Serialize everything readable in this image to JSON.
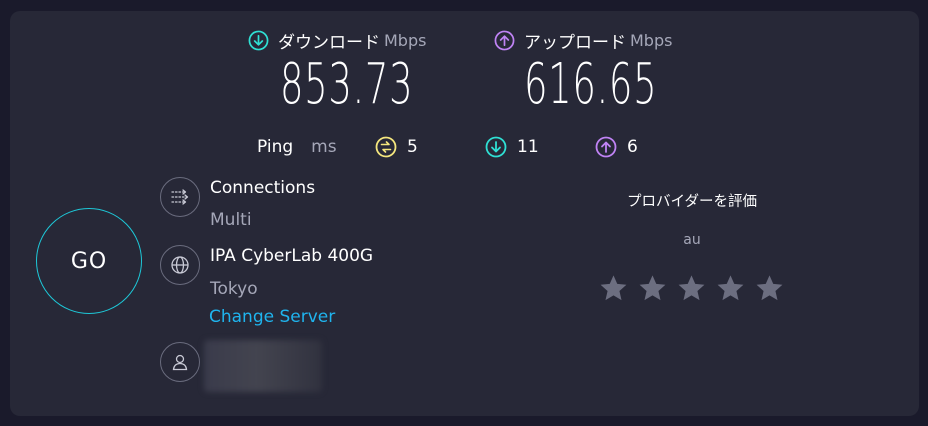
{
  "download": {
    "label": "ダウンロード",
    "unit": "Mbps",
    "value": "853.73",
    "icon": "arrow-down-circle-icon"
  },
  "upload": {
    "label": "アップロード",
    "unit": "Mbps",
    "value": "616.65",
    "icon": "arrow-up-circle-icon"
  },
  "ping": {
    "label": "Ping",
    "unit": "ms",
    "idle": "5",
    "download": "11",
    "upload": "6"
  },
  "go_button": {
    "label": "GO"
  },
  "connections": {
    "title": "Connections",
    "value": "Multi",
    "icon": "connections-icon"
  },
  "server": {
    "name": "IPA CyberLab 400G",
    "location": "Tokyo",
    "change_label": "Change Server",
    "icon": "globe-icon"
  },
  "user": {
    "icon": "user-icon"
  },
  "rating": {
    "title": "プロバイダーを評価",
    "isp": "au",
    "stars": 5,
    "filled": 0
  },
  "colors": {
    "download": "#2fe0d4",
    "upload": "#c083f5",
    "idle": "#f5e77e",
    "go_ring": "#1ec8d8",
    "link": "#1fb4ee",
    "star": "#6c6e80"
  }
}
